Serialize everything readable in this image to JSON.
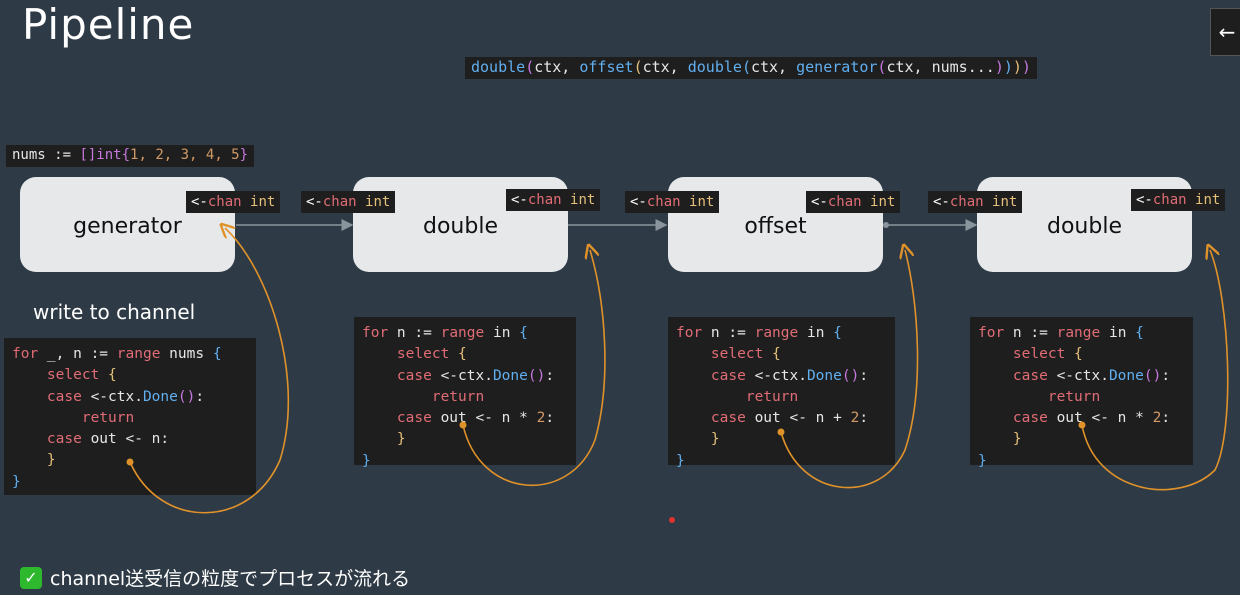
{
  "title": "Pipeline",
  "nav_button": "←",
  "expression": {
    "parts": [
      {
        "t": "double",
        "c": "fn"
      },
      {
        "t": "(",
        "c": "br1"
      },
      {
        "t": "ctx, ",
        "c": ""
      },
      {
        "t": "offset",
        "c": "fn"
      },
      {
        "t": "(",
        "c": "br2"
      },
      {
        "t": "ctx, ",
        "c": ""
      },
      {
        "t": "double",
        "c": "fn"
      },
      {
        "t": "(",
        "c": "br3"
      },
      {
        "t": "ctx, ",
        "c": ""
      },
      {
        "t": "generator",
        "c": "fn"
      },
      {
        "t": "(",
        "c": "br1"
      },
      {
        "t": "ctx, nums...",
        "c": ""
      },
      {
        "t": ")",
        "c": "br1"
      },
      {
        "t": ")",
        "c": "br3"
      },
      {
        "t": ")",
        "c": "br2"
      },
      {
        "t": ")",
        "c": "br1"
      }
    ]
  },
  "nums_decl": {
    "parts": [
      {
        "t": "nums := ",
        "c": ""
      },
      {
        "t": "[]",
        "c": "br1"
      },
      {
        "t": "int",
        "c": "kw"
      },
      {
        "t": "{",
        "c": "br1"
      },
      {
        "t": "1, 2, 3, 4, 5",
        "c": "num"
      },
      {
        "t": "}",
        "c": "br1"
      }
    ]
  },
  "chan_label": {
    "arrow": "<-",
    "chan": "chan",
    "type": "int"
  },
  "stages": [
    {
      "name": "generator"
    },
    {
      "name": "double"
    },
    {
      "name": "offset"
    },
    {
      "name": "double"
    }
  ],
  "write_label": "write to channel",
  "code_blocks": [
    {
      "lines": [
        [
          {
            "t": "for",
            "c": "kw2"
          },
          {
            "t": " _, n := ",
            "c": ""
          },
          {
            "t": "range",
            "c": "kw2"
          },
          {
            "t": " nums ",
            "c": ""
          },
          {
            "t": "{",
            "c": "br3"
          }
        ],
        [
          {
            "t": "    ",
            "c": ""
          },
          {
            "t": "select",
            "c": "kw2"
          },
          {
            "t": " ",
            "c": ""
          },
          {
            "t": "{",
            "c": "br2"
          }
        ],
        [
          {
            "t": "    ",
            "c": ""
          },
          {
            "t": "case",
            "c": "kw2"
          },
          {
            "t": " <-ctx.",
            "c": ""
          },
          {
            "t": "Done",
            "c": "fn"
          },
          {
            "t": "()",
            "c": "br1"
          },
          {
            "t": ":",
            "c": ""
          }
        ],
        [
          {
            "t": "        ",
            "c": ""
          },
          {
            "t": "return",
            "c": "kw2"
          }
        ],
        [
          {
            "t": "    ",
            "c": ""
          },
          {
            "t": "case",
            "c": "kw2"
          },
          {
            "t": " out <- n:",
            "c": ""
          }
        ],
        [
          {
            "t": "    ",
            "c": ""
          },
          {
            "t": "}",
            "c": "br2"
          }
        ],
        [
          {
            "t": "}",
            "c": "br3"
          }
        ]
      ]
    },
    {
      "lines": [
        [
          {
            "t": "for",
            "c": "kw2"
          },
          {
            "t": " n := ",
            "c": ""
          },
          {
            "t": "range",
            "c": "kw2"
          },
          {
            "t": " in ",
            "c": ""
          },
          {
            "t": "{",
            "c": "br3"
          }
        ],
        [
          {
            "t": "    ",
            "c": ""
          },
          {
            "t": "select",
            "c": "kw2"
          },
          {
            "t": " ",
            "c": ""
          },
          {
            "t": "{",
            "c": "br2"
          }
        ],
        [
          {
            "t": "    ",
            "c": ""
          },
          {
            "t": "case",
            "c": "kw2"
          },
          {
            "t": " <-ctx.",
            "c": ""
          },
          {
            "t": "Done",
            "c": "fn"
          },
          {
            "t": "()",
            "c": "br1"
          },
          {
            "t": ":",
            "c": ""
          }
        ],
        [
          {
            "t": "        ",
            "c": ""
          },
          {
            "t": "return",
            "c": "kw2"
          }
        ],
        [
          {
            "t": "    ",
            "c": ""
          },
          {
            "t": "case",
            "c": "kw2"
          },
          {
            "t": " out <- n * ",
            "c": ""
          },
          {
            "t": "2",
            "c": "num"
          },
          {
            "t": ":",
            "c": ""
          }
        ],
        [
          {
            "t": "    ",
            "c": ""
          },
          {
            "t": "}",
            "c": "br2"
          }
        ],
        [
          {
            "t": "}",
            "c": "br3"
          }
        ]
      ]
    },
    {
      "lines": [
        [
          {
            "t": "for",
            "c": "kw2"
          },
          {
            "t": " n := ",
            "c": ""
          },
          {
            "t": "range",
            "c": "kw2"
          },
          {
            "t": " in ",
            "c": ""
          },
          {
            "t": "{",
            "c": "br3"
          }
        ],
        [
          {
            "t": "    ",
            "c": ""
          },
          {
            "t": "select",
            "c": "kw2"
          },
          {
            "t": " ",
            "c": ""
          },
          {
            "t": "{",
            "c": "br2"
          }
        ],
        [
          {
            "t": "    ",
            "c": ""
          },
          {
            "t": "case",
            "c": "kw2"
          },
          {
            "t": " <-ctx.",
            "c": ""
          },
          {
            "t": "Done",
            "c": "fn"
          },
          {
            "t": "()",
            "c": "br1"
          },
          {
            "t": ":",
            "c": ""
          }
        ],
        [
          {
            "t": "        ",
            "c": ""
          },
          {
            "t": "return",
            "c": "kw2"
          }
        ],
        [
          {
            "t": "    ",
            "c": ""
          },
          {
            "t": "case",
            "c": "kw2"
          },
          {
            "t": " out <- n + ",
            "c": ""
          },
          {
            "t": "2",
            "c": "num"
          },
          {
            "t": ":",
            "c": ""
          }
        ],
        [
          {
            "t": "    ",
            "c": ""
          },
          {
            "t": "}",
            "c": "br2"
          }
        ],
        [
          {
            "t": "}",
            "c": "br3"
          }
        ]
      ]
    },
    {
      "lines": [
        [
          {
            "t": "for",
            "c": "kw2"
          },
          {
            "t": " n := ",
            "c": ""
          },
          {
            "t": "range",
            "c": "kw2"
          },
          {
            "t": " in ",
            "c": ""
          },
          {
            "t": "{",
            "c": "br3"
          }
        ],
        [
          {
            "t": "    ",
            "c": ""
          },
          {
            "t": "select",
            "c": "kw2"
          },
          {
            "t": " ",
            "c": ""
          },
          {
            "t": "{",
            "c": "br2"
          }
        ],
        [
          {
            "t": "    ",
            "c": ""
          },
          {
            "t": "case",
            "c": "kw2"
          },
          {
            "t": " <-ctx.",
            "c": ""
          },
          {
            "t": "Done",
            "c": "fn"
          },
          {
            "t": "()",
            "c": "br1"
          },
          {
            "t": ":",
            "c": ""
          }
        ],
        [
          {
            "t": "        ",
            "c": ""
          },
          {
            "t": "return",
            "c": "kw2"
          }
        ],
        [
          {
            "t": "    ",
            "c": ""
          },
          {
            "t": "case",
            "c": "kw2"
          },
          {
            "t": " out <- n * ",
            "c": ""
          },
          {
            "t": "2",
            "c": "num"
          },
          {
            "t": ":",
            "c": ""
          }
        ],
        [
          {
            "t": "    ",
            "c": ""
          },
          {
            "t": "}",
            "c": "br2"
          }
        ],
        [
          {
            "t": "}",
            "c": "br3"
          }
        ]
      ]
    }
  ],
  "note": {
    "check": "✓",
    "text": "channel送受信の粒度でプロセスが流れる"
  },
  "colors": {
    "background": "#2e3a45",
    "stage_fill": "#e6e8ea",
    "code_bg": "#1e1e1e",
    "annotation": "#e0922a",
    "connector": "#8a949c"
  }
}
